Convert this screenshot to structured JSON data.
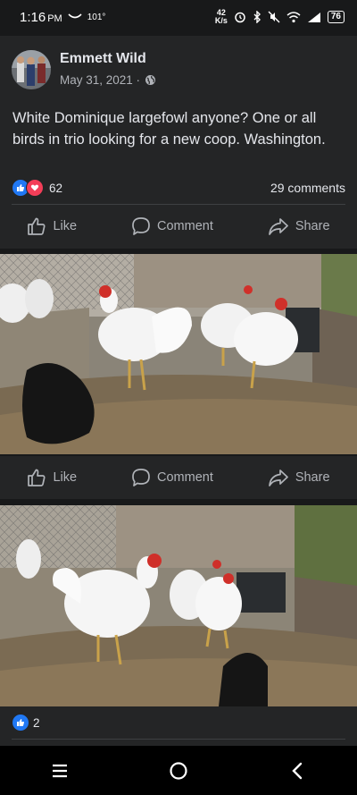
{
  "status": {
    "time": "1:16",
    "ampm": "PM",
    "temp": "101°",
    "net_speed_top": "42",
    "net_speed_unit": "K/s",
    "battery": "76"
  },
  "post": {
    "author": "Emmett Wild",
    "date": "May 31, 2021 ·",
    "text": "White Dominique largefowl anyone? One or all birds in trio looking for a new coop. Washington.",
    "reaction_count": "62",
    "comments_label": "29 comments"
  },
  "actions": {
    "like": "Like",
    "comment": "Comment",
    "share": "Share"
  },
  "photo2": {
    "reaction_count": "2"
  },
  "colors": {
    "background": "#18191a",
    "card": "#242526",
    "like_blue": "#2078f4",
    "love_red": "#f33e58"
  }
}
